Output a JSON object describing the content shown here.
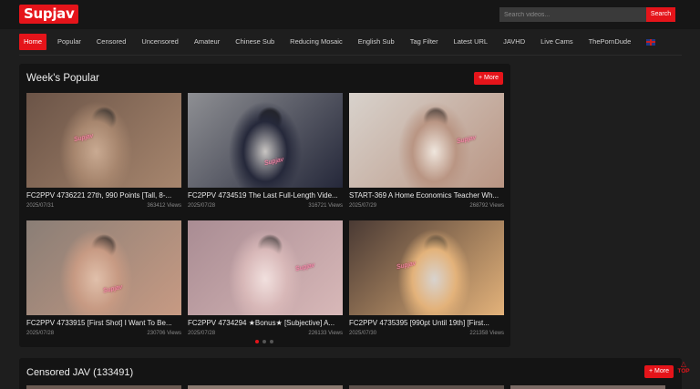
{
  "header": {
    "logo": "Supjav",
    "search_placeholder": "Search videos...",
    "search_button": "Search"
  },
  "nav": {
    "items": [
      {
        "label": "Home",
        "active": true
      },
      {
        "label": "Popular"
      },
      {
        "label": "Censored"
      },
      {
        "label": "Uncensored"
      },
      {
        "label": "Amateur"
      },
      {
        "label": "Chinese Sub"
      },
      {
        "label": "Reducing Mosaic"
      },
      {
        "label": "English Sub"
      },
      {
        "label": "Tag Filter"
      },
      {
        "label": "Latest URL"
      },
      {
        "label": "JAVHD"
      },
      {
        "label": "Live Cams"
      },
      {
        "label": "ThePornDude"
      }
    ],
    "language_icon": "uk-flag-icon"
  },
  "popular": {
    "title": "Week's Popular",
    "more": "+ More",
    "watermark": "Supjav",
    "cards": [
      {
        "title": "FC2PPV 4736221 27th, 990 Points [Tall, 8-...",
        "date": "2025/07/31",
        "views": "363412 Views",
        "palette": [
          "#6b5447",
          "#a7866e",
          "#c9aa92"
        ]
      },
      {
        "title": "FC2PPV 4734519 The Last Full-Length Vide...",
        "date": "2025/07/28",
        "views": "316721 Views",
        "palette": [
          "#8e8f93",
          "#25283a",
          "#c9c6c3"
        ]
      },
      {
        "title": "START-369 A Home Economics Teacher Wh...",
        "date": "2025/07/29",
        "views": "268792 Views",
        "palette": [
          "#d8d2cc",
          "#b99583",
          "#efe6dd"
        ]
      },
      {
        "title": "FC2PPV 4733915 [First Shot] I Want To Be...",
        "date": "2025/07/28",
        "views": "230706 Views",
        "palette": [
          "#8a7e76",
          "#c79a83",
          "#e0c0ab"
        ]
      },
      {
        "title": "FC2PPV 4734294 ★Bonus★ [Subjective] A...",
        "date": "2025/07/28",
        "views": "226133 Views",
        "palette": [
          "#a98c93",
          "#d8b8b8",
          "#f1e0de"
        ]
      },
      {
        "title": "FC2PPV 4735395 [990pt Until 19th] [First...",
        "date": "2025/07/30",
        "views": "221358 Views",
        "palette": [
          "#4a3a34",
          "#e3b27a",
          "#d8d3cf"
        ]
      }
    ]
  },
  "censored": {
    "title": "Censored JAV (133491)",
    "more": "+ More"
  },
  "back_to_top": {
    "label": "TOP",
    "icon": "arrow-up-icon"
  },
  "colors": {
    "accent": "#e5141a",
    "background": "#1e1e1e",
    "panel": "#141414"
  }
}
